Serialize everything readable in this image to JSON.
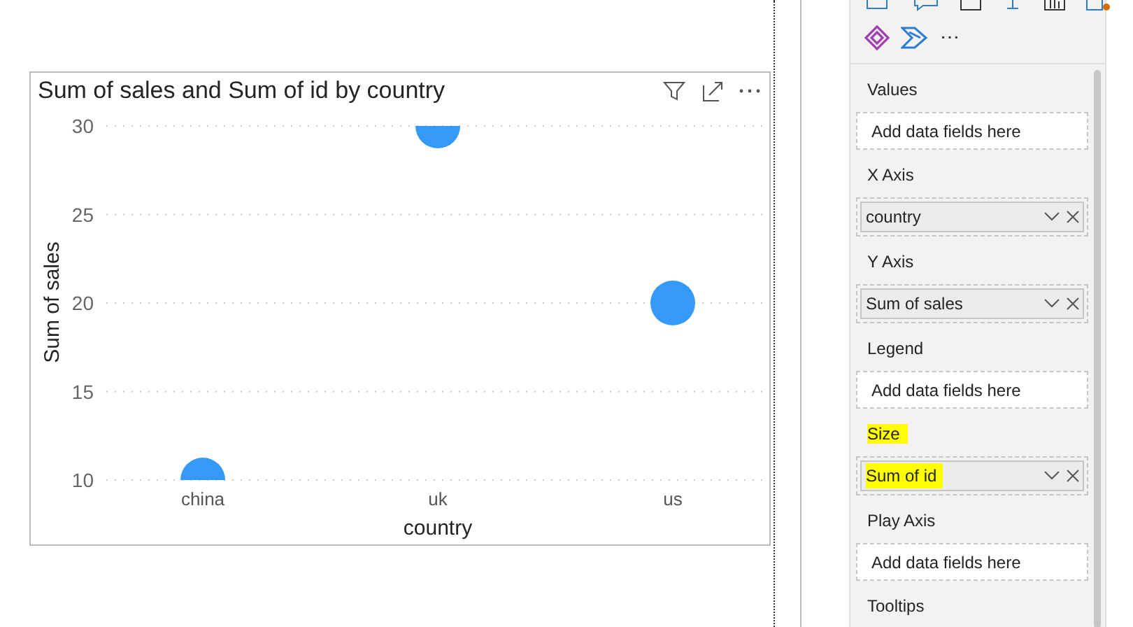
{
  "visual": {
    "title": "Sum of sales and Sum of id by country",
    "chart_data": {
      "type": "scatter",
      "xlabel": "country",
      "ylabel": "Sum of sales",
      "categories": [
        "china",
        "uk",
        "us"
      ],
      "ylim": [
        10,
        30
      ],
      "grid": true,
      "yticks": [
        10,
        15,
        20,
        25,
        30
      ],
      "series": [
        {
          "color": "#3599f8",
          "values": [
            10,
            30,
            20
          ]
        }
      ]
    }
  },
  "pane": {
    "more": "⋯",
    "wells": [
      {
        "label": "Values",
        "highlighted": false,
        "kind": "empty",
        "placeholder": "Add data fields here"
      },
      {
        "label": "X Axis",
        "highlighted": false,
        "kind": "field",
        "field": "country",
        "field_highlighted": false
      },
      {
        "label": "Y Axis",
        "highlighted": false,
        "kind": "field",
        "field": "Sum of sales",
        "field_highlighted": false
      },
      {
        "label": "Legend",
        "highlighted": false,
        "kind": "empty",
        "placeholder": "Add data fields here"
      },
      {
        "label": "Size",
        "highlighted": true,
        "kind": "field",
        "field": "Sum of id",
        "field_highlighted": true
      },
      {
        "label": "Play Axis",
        "highlighted": false,
        "kind": "empty",
        "placeholder": "Add data fields here"
      },
      {
        "label": "Tooltips",
        "highlighted": false,
        "kind": "label"
      }
    ]
  }
}
